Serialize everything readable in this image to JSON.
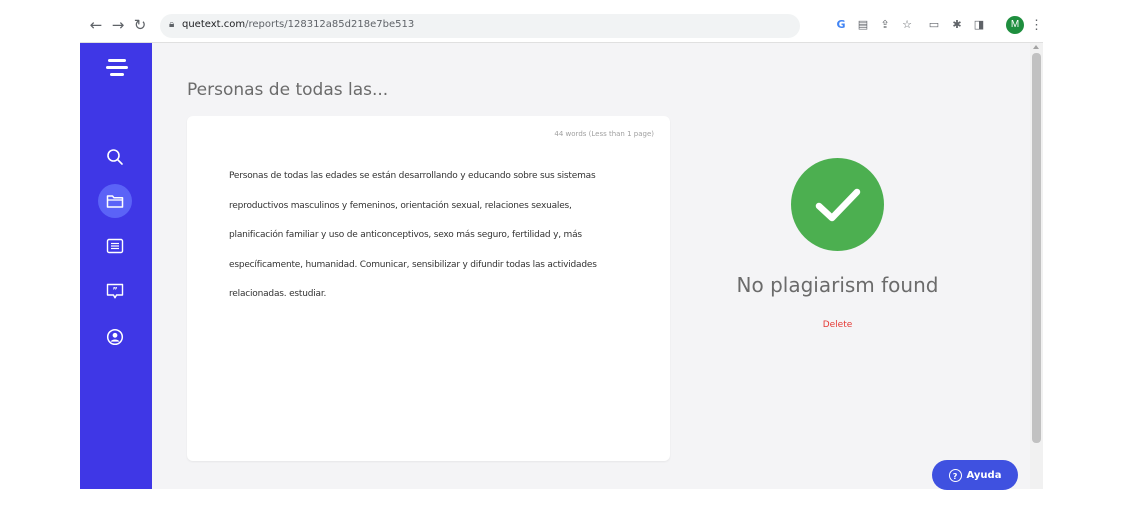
{
  "browser": {
    "url_host": "quetext.com",
    "url_path": "/reports/128312a85d218e7be513",
    "profile_initial": "M"
  },
  "sidebar": {
    "items": [
      {
        "icon": "search-icon"
      },
      {
        "icon": "folder-icon",
        "active": true
      },
      {
        "icon": "list-icon"
      },
      {
        "icon": "quote-icon"
      },
      {
        "icon": "account-icon"
      }
    ]
  },
  "report": {
    "title": "Personas de todas las...",
    "word_count": "44 words (Less than 1 page)",
    "text_lines": [
      "Personas de todas las edades se están desarrollando y educando sobre sus sistemas",
      "reproductivos masculinos y femeninos, orientación sexual, relaciones sexuales,",
      "planificación familiar y uso de anticonceptivos, sexo más seguro, fertilidad y, más",
      "específicamente, humanidad. Comunicar, sensibilizar y difundir todas las actividades",
      "relacionadas. estudiar."
    ]
  },
  "result": {
    "status": "No plagiarism found",
    "delete_label": "Delete",
    "color": "#4caf50"
  },
  "help": {
    "label": "Ayuda"
  },
  "colors": {
    "sidebar": "#3f37e6",
    "accent": "#3f51e0",
    "delete": "#e53935"
  }
}
